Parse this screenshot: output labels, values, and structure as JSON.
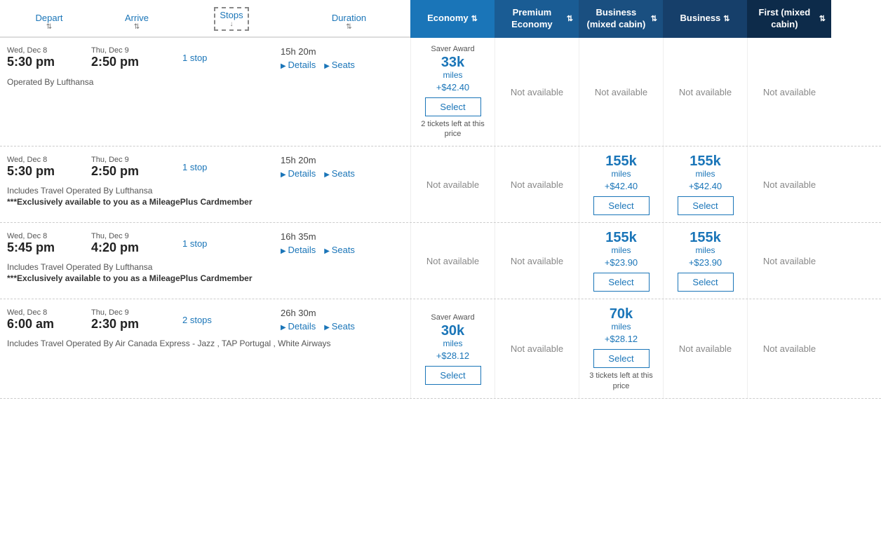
{
  "columns": {
    "economy": {
      "label": "Economy",
      "class": "economy"
    },
    "premium_economy": {
      "label": "Premium Economy",
      "class": "premium-economy"
    },
    "business_mixed": {
      "label": "Business (mixed cabin)",
      "class": "business-mixed"
    },
    "business": {
      "label": "Business",
      "class": "business"
    },
    "first_mixed": {
      "label": "First (mixed cabin)",
      "class": "first-mixed"
    }
  },
  "sort_headers": [
    {
      "label": "Depart",
      "id": "depart"
    },
    {
      "label": "Arrive",
      "id": "arrive"
    },
    {
      "label": "Stops",
      "id": "stops",
      "dashed": true
    },
    {
      "label": "Duration",
      "id": "duration"
    }
  ],
  "flights": [
    {
      "id": "flight-1",
      "depart_date": "Wed, Dec 8",
      "depart_time": "5:30 pm",
      "arrive_date": "Thu, Dec 9",
      "arrive_time": "2:50 pm",
      "stops": "1 stop",
      "duration": "15h 20m",
      "operated_by": "Operated By Lufthansa",
      "exclusive": null,
      "economy": {
        "award_label": "Saver Award",
        "miles": "33k",
        "cash": "+$42.40",
        "select_label": "Select",
        "tickets_left": "2 tickets left at this price",
        "available": true
      },
      "premium_economy": {
        "available": false,
        "label": "Not available"
      },
      "business_mixed": {
        "available": false,
        "label": "Not available"
      },
      "business": {
        "available": false,
        "label": "Not available"
      },
      "first_mixed": {
        "available": false,
        "label": "Not available"
      }
    },
    {
      "id": "flight-2",
      "depart_date": "Wed, Dec 8",
      "depart_time": "5:30 pm",
      "arrive_date": "Thu, Dec 9",
      "arrive_time": "2:50 pm",
      "stops": "1 stop",
      "duration": "15h 20m",
      "operated_by": "Includes Travel Operated By Lufthansa",
      "exclusive": "***Exclusively available to you as a MileagePlus Cardmember",
      "economy": {
        "available": false,
        "label": "Not available"
      },
      "premium_economy": {
        "available": false,
        "label": "Not available"
      },
      "business_mixed": {
        "award_label": null,
        "miles": "155k",
        "cash": "+$42.40",
        "select_label": "Select",
        "tickets_left": null,
        "available": true
      },
      "business": {
        "award_label": null,
        "miles": "155k",
        "cash": "+$42.40",
        "select_label": "Select",
        "tickets_left": null,
        "available": true
      },
      "first_mixed": {
        "available": false,
        "label": "Not available"
      }
    },
    {
      "id": "flight-3",
      "depart_date": "Wed, Dec 8",
      "depart_time": "5:45 pm",
      "arrive_date": "Thu, Dec 9",
      "arrive_time": "4:20 pm",
      "stops": "1 stop",
      "duration": "16h 35m",
      "operated_by": "Includes Travel Operated By Lufthansa",
      "exclusive": "***Exclusively available to you as a MileagePlus Cardmember",
      "economy": {
        "available": false,
        "label": "Not available"
      },
      "premium_economy": {
        "available": false,
        "label": "Not available"
      },
      "business_mixed": {
        "award_label": null,
        "miles": "155k",
        "cash": "+$23.90",
        "select_label": "Select",
        "tickets_left": null,
        "available": true
      },
      "business": {
        "award_label": null,
        "miles": "155k",
        "cash": "+$23.90",
        "select_label": "Select",
        "tickets_left": null,
        "available": true
      },
      "first_mixed": {
        "available": false,
        "label": "Not available"
      }
    },
    {
      "id": "flight-4",
      "depart_date": "Wed, Dec 8",
      "depart_time": "6:00 am",
      "arrive_date": "Thu, Dec 9",
      "arrive_time": "2:30 pm",
      "stops": "2 stops",
      "duration": "26h 30m",
      "operated_by": "Includes Travel Operated By Air Canada Express - Jazz , TAP Portugal , White Airways",
      "exclusive": null,
      "economy": {
        "award_label": "Saver Award",
        "miles": "30k",
        "cash": "+$28.12",
        "select_label": "Select",
        "tickets_left": null,
        "available": true
      },
      "premium_economy": {
        "available": false,
        "label": "Not available"
      },
      "business_mixed": {
        "award_label": null,
        "miles": "70k",
        "cash": "+$28.12",
        "select_label": "Select",
        "tickets_left": "3 tickets left at this price",
        "available": true
      },
      "business": {
        "available": false,
        "label": "Not available"
      },
      "first_mixed": {
        "available": false,
        "label": "Not available"
      }
    }
  ],
  "labels": {
    "not_available": "Not available",
    "miles_unit": "miles",
    "details": "Details",
    "seats": "Seats"
  }
}
